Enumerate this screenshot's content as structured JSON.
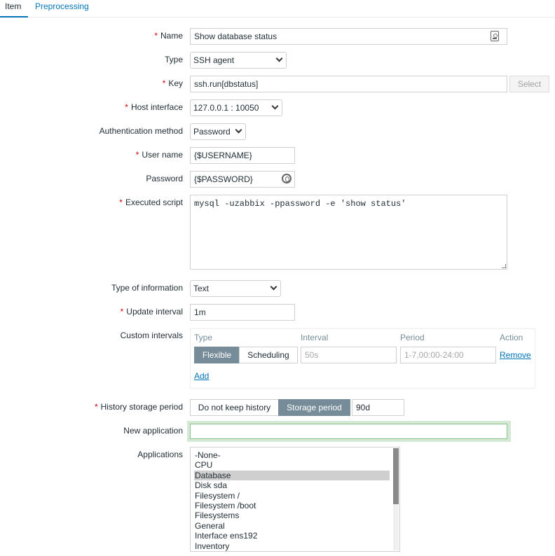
{
  "tabs": [
    {
      "label": "Item"
    },
    {
      "label": "Preprocessing"
    }
  ],
  "form": {
    "name_label": "Name",
    "name_value": "Show database status",
    "type_label": "Type",
    "type_value": "SSH agent",
    "key_label": "Key",
    "key_value": "ssh.run[dbstatus]",
    "select_button": "Select",
    "host_interface_label": "Host interface",
    "host_interface_value": "127.0.0.1 : 10050",
    "auth_method_label": "Authentication method",
    "auth_method_value": "Password",
    "username_label": "User name",
    "username_value": "{$USERNAME}",
    "password_label": "Password",
    "password_value": "{$PASSWORD}",
    "script_label": "Executed script",
    "script_value": "mysql -uzabbix -ppassword -e 'show status'",
    "type_of_info_label": "Type of information",
    "type_of_info_value": "Text",
    "update_interval_label": "Update interval",
    "update_interval_value": "1m",
    "custom_intervals_label": "Custom intervals",
    "custom_intervals": {
      "headers": {
        "type": "Type",
        "interval": "Interval",
        "period": "Period",
        "action": "Action"
      },
      "flexible": "Flexible",
      "scheduling": "Scheduling",
      "interval_placeholder": "50s",
      "period_placeholder": "1-7,00:00-24:00",
      "remove": "Remove",
      "add": "Add"
    },
    "history_label": "History storage period",
    "history_no_keep": "Do not keep history",
    "history_storage": "Storage period",
    "history_value": "90d",
    "new_application_label": "New application",
    "applications_label": "Applications",
    "applications": [
      "-None-",
      "CPU",
      "Database",
      "Disk sda",
      "Filesystem /",
      "Filesystem /boot",
      "Filesystems",
      "General",
      "Interface ens192",
      "Inventory"
    ],
    "applications_selected": "Database"
  },
  "colors": {
    "accent": "#0275b8",
    "required": "#d40000",
    "toggle_on": "#768d99"
  }
}
